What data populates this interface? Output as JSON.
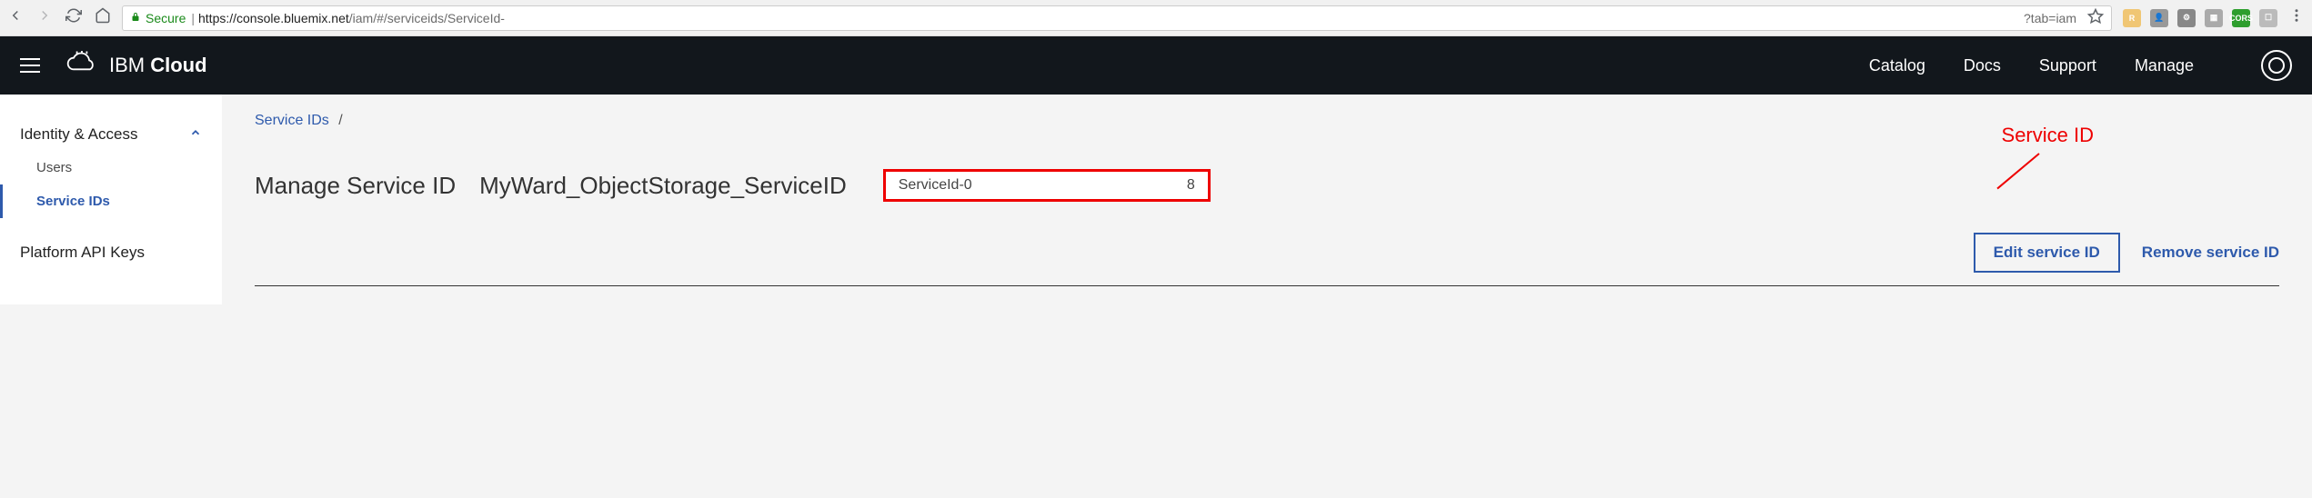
{
  "browser": {
    "secure_label": "Secure",
    "url_domain": "https://console.bluemix.net",
    "url_path": "/iam/#/serviceids/ServiceId-",
    "url_tab": "?tab=iam"
  },
  "header": {
    "brand_light": "IBM ",
    "brand_bold": "Cloud",
    "nav": {
      "catalog": "Catalog",
      "docs": "Docs",
      "support": "Support",
      "manage": "Manage"
    }
  },
  "sidebar": {
    "section": "Identity & Access",
    "users": "Users",
    "service_ids": "Service IDs",
    "platform_keys": "Platform API Keys"
  },
  "breadcrumb": {
    "root": "Service IDs",
    "sep": "/"
  },
  "main": {
    "title": "Manage Service ID",
    "service_name": "MyWard_ObjectStorage_ServiceID",
    "id_prefix": "ServiceId-0",
    "id_suffix": "8",
    "annotation": "Service ID",
    "edit_btn": "Edit service ID",
    "remove_btn": "Remove service ID"
  }
}
